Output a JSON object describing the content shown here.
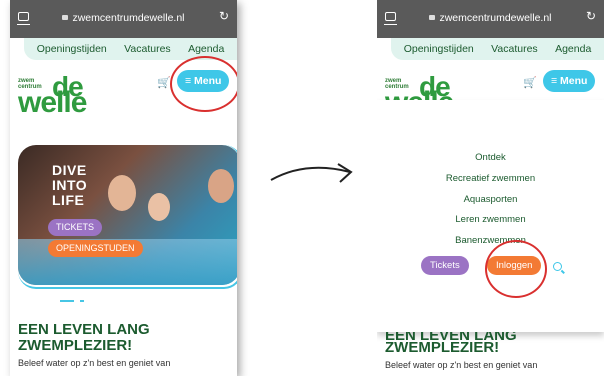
{
  "browser": {
    "url": "zwemcentrumdewelle.nl"
  },
  "topnav": {
    "items": [
      "Openingstijden",
      "Vacatures",
      "Agenda"
    ]
  },
  "logo": {
    "line1": "zwem",
    "line2": "centrum",
    "brand": "de welle"
  },
  "header": {
    "menu_label": "Menu"
  },
  "hero": {
    "title": "DIVE INTO LIFE",
    "tickets": "TICKETS",
    "opening": "OPENINGSTUDEN"
  },
  "content": {
    "headline_line1": "EEN LEVEN LANG",
    "headline_line2": "ZWEMPLEZIER!",
    "intro": "Beleef water op z'n best en geniet van"
  },
  "menu": {
    "items": [
      "Ontdek",
      "Recreatief zwemmen",
      "Aquasporten",
      "Leren zwemmen",
      "Banenzwemmen"
    ],
    "tickets": "Tickets",
    "login": "Inloggen"
  },
  "colors": {
    "green": "#1c5b2f",
    "cyan": "#3ec7e8",
    "purple": "#9b73c4",
    "orange": "#f37a34",
    "red": "#d9302f"
  }
}
